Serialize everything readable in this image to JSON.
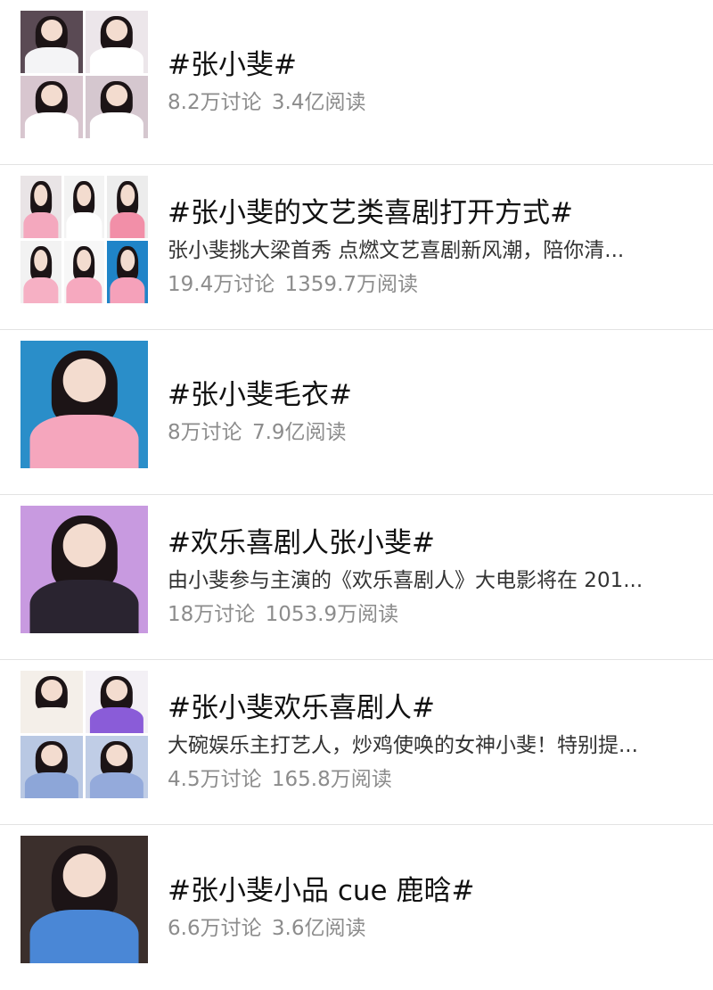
{
  "topics": [
    {
      "title": "#张小斐#",
      "desc": "",
      "discuss": "8.2万讨论",
      "reads": "3.4亿阅读",
      "thumb": "grid4",
      "bg": [
        "#5a4a54",
        "#ece6ea",
        "#d8c6cf",
        "#d5c7cf"
      ],
      "body": [
        "#f4f4f6",
        "#ffffff",
        "#ffffff",
        "#ffffff"
      ]
    },
    {
      "title": "#张小斐的文艺类喜剧打开方式#",
      "desc": "张小斐挑大梁首秀  点燃文艺喜剧新风潮，陪你清...",
      "discuss": "19.4万讨论",
      "reads": "1359.7万阅读",
      "thumb": "grid6",
      "bg": [
        "#e9e4e6",
        "#f3f3f3",
        "#ececec",
        "#f2f2f2",
        "#f7f7f7",
        "#1f84c8"
      ],
      "body": [
        "#f4a8be",
        "#ffffff",
        "#f28fa8",
        "#f6b0c4",
        "#f6a9bf",
        "#f5a1ba"
      ]
    },
    {
      "title": "#张小斐毛衣#",
      "desc": "",
      "discuss": "8万讨论",
      "reads": "7.9亿阅读",
      "thumb": "single",
      "bg": [
        "#2a8ec9"
      ],
      "body": [
        "#f5a6bd"
      ]
    },
    {
      "title": "#欢乐喜剧人张小斐#",
      "desc": "由小斐参与主演的《欢乐喜剧人》大电影将在 201...",
      "discuss": "18万讨论",
      "reads": "1053.9万阅读",
      "thumb": "single",
      "bg": [
        "#c89ae0"
      ],
      "body": [
        "#2a2430"
      ]
    },
    {
      "title": "#张小斐欢乐喜剧人#",
      "desc": "大碗娱乐主打艺人，炒鸡使唤的女神小斐！特别提...",
      "discuss": "4.5万讨论",
      "reads": "165.8万阅读",
      "thumb": "grid4",
      "bg": [
        "#f4efe9",
        "#f3f0f5",
        "#b9c8e3",
        "#c0cde6"
      ],
      "body": [
        "#f4efe9",
        "#8a5cd8",
        "#8da6d8",
        "#94aadb"
      ]
    },
    {
      "title": "#张小斐小品 cue 鹿晗#",
      "desc": "",
      "discuss": "6.6万讨论",
      "reads": "3.6亿阅读",
      "thumb": "single",
      "bg": [
        "#3b2f2c"
      ],
      "body": [
        "#4a87d6"
      ]
    }
  ]
}
